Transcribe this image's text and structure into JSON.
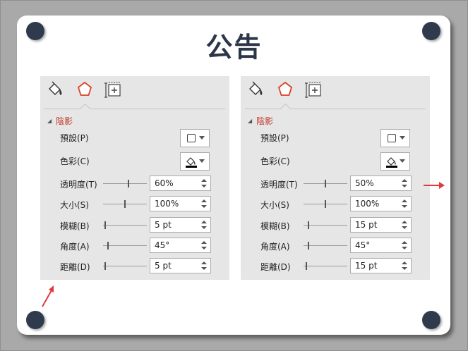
{
  "title": "公告",
  "panels": [
    {
      "section": "陰影",
      "preset_label": "預設(P)",
      "color_label": "色彩(C)",
      "rows": [
        {
          "label": "透明度(T)",
          "value": "60%",
          "level": 0.6
        },
        {
          "label": "大小(S)",
          "value": "100%",
          "level": 0.5
        },
        {
          "label": "模糊(B)",
          "value": "5 pt",
          "level": 0.03
        },
        {
          "label": "角度(A)",
          "value": "45°",
          "level": 0.125
        },
        {
          "label": "距離(D)",
          "value": "5 pt",
          "level": 0.03
        }
      ]
    },
    {
      "section": "陰影",
      "preset_label": "預設(P)",
      "color_label": "色彩(C)",
      "rows": [
        {
          "label": "透明度(T)",
          "value": "50%",
          "level": 0.5
        },
        {
          "label": "大小(S)",
          "value": "100%",
          "level": 0.5
        },
        {
          "label": "模糊(B)",
          "value": "15 pt",
          "level": 0.1
        },
        {
          "label": "角度(A)",
          "value": "45°",
          "level": 0.125
        },
        {
          "label": "距離(D)",
          "value": "15 pt",
          "level": 0.07
        }
      ]
    }
  ],
  "colors": {
    "accent": "#c0392b",
    "pin": "#2f3b4d",
    "arrow": "#e03a3a"
  },
  "icons": [
    "paint-bucket-icon",
    "pentagon-effects-icon",
    "size-properties-icon"
  ]
}
